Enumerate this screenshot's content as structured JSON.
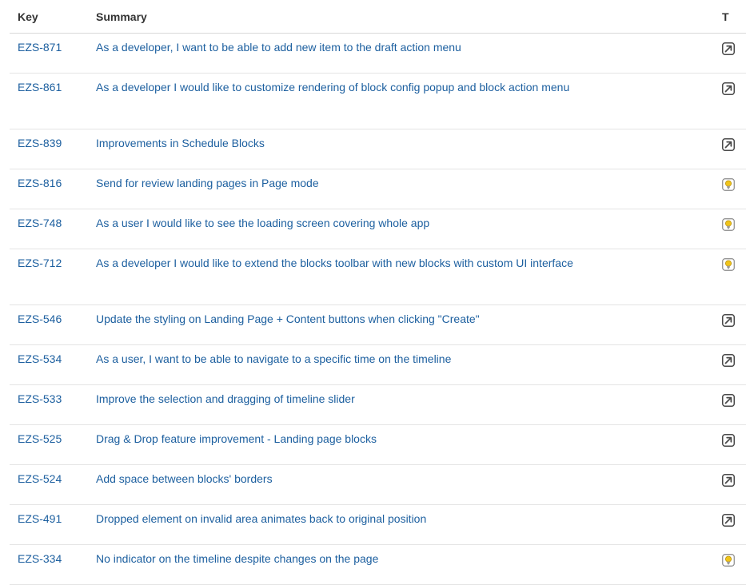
{
  "table": {
    "headers": {
      "key": "Key",
      "summary": "Summary",
      "type": "T"
    },
    "rows": [
      {
        "key": "EZS-871",
        "summary": "As a developer, I want to be able to add new item to the draft action menu",
        "type": "improvement-icon",
        "lines": 1
      },
      {
        "key": "EZS-861",
        "summary": "As a developer I would like to customize rendering of block config popup and block action menu",
        "type": "improvement-icon",
        "lines": 2
      },
      {
        "key": "EZS-839",
        "summary": "Improvements in Schedule Blocks",
        "type": "improvement-icon",
        "lines": 1
      },
      {
        "key": "EZS-816",
        "summary": "Send for review landing pages in Page mode",
        "type": "idea-icon",
        "lines": 1
      },
      {
        "key": "EZS-748",
        "summary": "As a user I would like to see the loading screen covering whole app",
        "type": "idea-icon",
        "lines": 1
      },
      {
        "key": "EZS-712",
        "summary": "As a developer I would like to extend the blocks toolbar with new blocks with custom UI interface",
        "type": "idea-icon",
        "lines": 2
      },
      {
        "key": "EZS-546",
        "summary": "Update the styling on Landing Page + Content buttons when clicking \"Create\"",
        "type": "improvement-icon",
        "lines": 1
      },
      {
        "key": "EZS-534",
        "summary": "As a user, I want to be able to navigate to a specific time on the timeline",
        "type": "improvement-icon",
        "lines": 1
      },
      {
        "key": "EZS-533",
        "summary": "Improve the selection and dragging of timeline slider",
        "type": "improvement-icon",
        "lines": 1
      },
      {
        "key": "EZS-525",
        "summary": "Drag & Drop feature improvement - Landing page blocks",
        "type": "improvement-icon",
        "lines": 1
      },
      {
        "key": "EZS-524",
        "summary": "Add space between blocks' borders",
        "type": "improvement-icon",
        "lines": 1
      },
      {
        "key": "EZS-491",
        "summary": "Dropped element on invalid area animates back to original position",
        "type": "improvement-icon",
        "lines": 1
      },
      {
        "key": "EZS-334",
        "summary": "No indicator on the timeline despite changes on the page",
        "type": "idea-icon",
        "lines": 1
      }
    ]
  },
  "colors": {
    "link": "#1c5f9f",
    "header_text": "#333333",
    "row_border": "#e4e4e4",
    "improvement_icon": "#4a4a4a",
    "idea_icon": "#f0c419"
  }
}
